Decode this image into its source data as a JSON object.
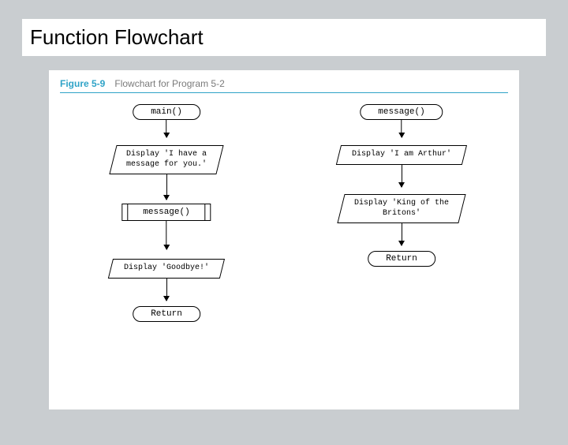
{
  "slide": {
    "title": "Function Flowchart"
  },
  "figure": {
    "label": "Figure 5-9",
    "caption": "Flowchart for Program 5-2"
  },
  "flow_left": {
    "start": "main()",
    "io1": "Display 'I have a\nmessage for you.'",
    "sub": "message()",
    "io2": "Display 'Goodbye!'",
    "end": "Return"
  },
  "flow_right": {
    "start": "message()",
    "io1": "Display 'I am Arthur'",
    "io2": "Display 'King of the\nBritons'",
    "end": "Return"
  }
}
